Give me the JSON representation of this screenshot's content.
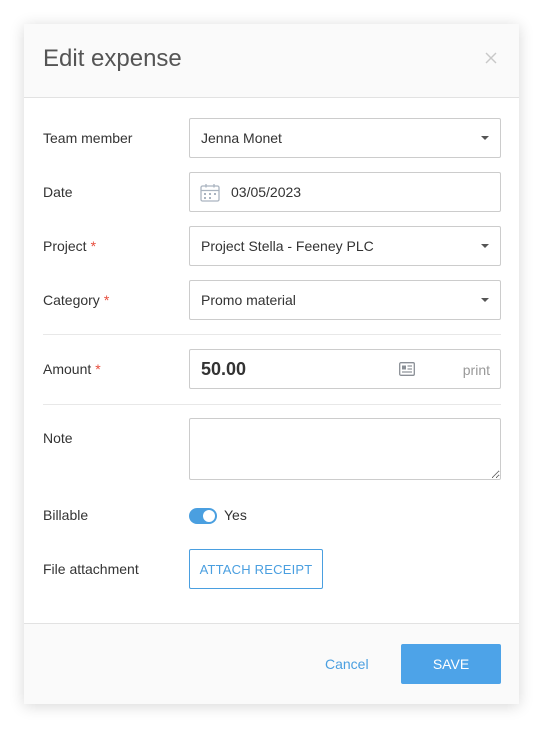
{
  "modal": {
    "title": "Edit expense",
    "close_icon": "close-icon"
  },
  "form": {
    "team_member": {
      "label": "Team member",
      "value": "Jenna Monet"
    },
    "date": {
      "label": "Date",
      "value": "03/05/2023",
      "icon": "calendar-icon"
    },
    "project": {
      "label": "Project",
      "required_mark": "*",
      "value": "Project Stella - Feeney PLC"
    },
    "category": {
      "label": "Category",
      "required_mark": "*",
      "value": "Promo material"
    },
    "amount": {
      "label": "Amount",
      "required_mark": "*",
      "value": "50.00",
      "print_label": "print",
      "icon": "id-card-icon"
    },
    "note": {
      "label": "Note",
      "value": ""
    },
    "billable": {
      "label": "Billable",
      "state_label": "Yes",
      "enabled": true
    },
    "attachment": {
      "label": "File attachment",
      "button_label": "ATTACH RECEIPT"
    }
  },
  "footer": {
    "cancel_label": "Cancel",
    "save_label": "SAVE"
  },
  "colors": {
    "accent": "#4a9fe0",
    "required": "#e74c3c"
  }
}
